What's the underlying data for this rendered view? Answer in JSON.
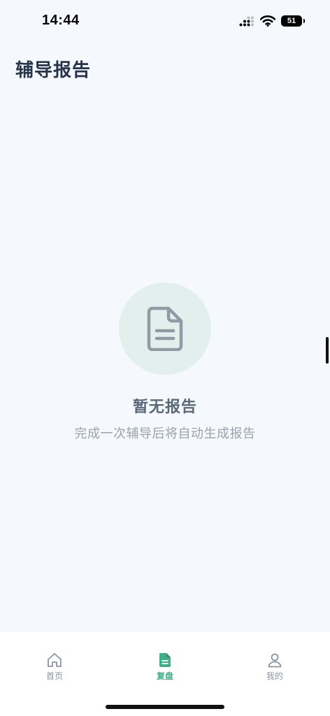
{
  "status_bar": {
    "time": "14:44",
    "battery": "51",
    "icons": [
      "signal-icon",
      "wifi-icon",
      "battery-icon"
    ]
  },
  "header": {
    "title": "辅导报告"
  },
  "empty_state": {
    "icon": "document-icon",
    "title": "暂无报告",
    "subtitle": "完成一次辅导后将自动生成报告"
  },
  "tab_bar": {
    "tabs": [
      {
        "label": "首页",
        "icon": "home-icon",
        "active": false
      },
      {
        "label": "复盘",
        "icon": "document-icon",
        "active": true
      },
      {
        "label": "我的",
        "icon": "person-icon",
        "active": false
      }
    ],
    "active_color": "#3fae86",
    "inactive_color": "#8b95a1"
  },
  "colors": {
    "background": "#f5f8fd",
    "icon_circle": "#e3efed",
    "title_text": "#27344a"
  }
}
